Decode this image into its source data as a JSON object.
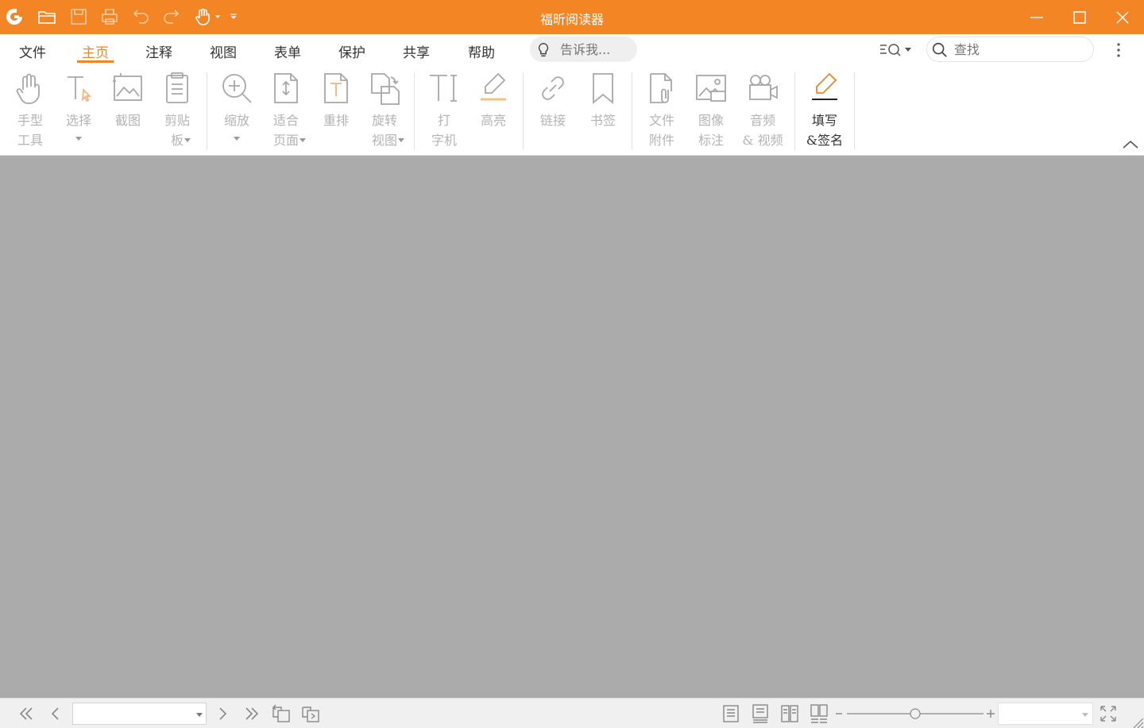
{
  "window": {
    "title": "福昕阅读器",
    "accent_color": "#f48525",
    "quick_access_icons": [
      "foxit-logo-icon",
      "open-folder-icon",
      "save-icon",
      "print-icon",
      "undo-icon",
      "redo-icon",
      "hand-tool-icon",
      "customize-toolbar-icon"
    ],
    "controls": [
      "minimize-icon",
      "maximize-icon",
      "close-icon"
    ]
  },
  "tabs": [
    {
      "label": "文件",
      "active": false
    },
    {
      "label": "主页",
      "active": true
    },
    {
      "label": "注释",
      "active": false
    },
    {
      "label": "视图",
      "active": false
    },
    {
      "label": "表单",
      "active": false
    },
    {
      "label": "保护",
      "active": false
    },
    {
      "label": "共享",
      "active": false
    },
    {
      "label": "帮助",
      "active": false
    }
  ],
  "tell_me": {
    "placeholder": "告诉我..."
  },
  "find": {
    "placeholder": "查找"
  },
  "ribbon": {
    "hand_tool": "手型\n工具",
    "select": "选择",
    "snapshot": "截图",
    "clipboard": "剪贴\n板",
    "zoom": "缩放",
    "fit_page": "适合\n页面",
    "reflow": "重排",
    "rotate_view": "旋转\n视图",
    "typewriter": "打\n字机",
    "highlight": "高亮",
    "link": "链接",
    "bookmark": "书签",
    "file_attachment": "文件\n附件",
    "image_annotation": "图像\n标注",
    "audio_video": "音频\n& 视频",
    "fill_sign": "填写\n&签名"
  },
  "status_bar": {
    "page_value": "",
    "zoom_value": "",
    "icons": [
      "first-page-icon",
      "previous-page-icon",
      "next-page-icon",
      "last-page-icon",
      "previous-view-icon",
      "next-view-icon",
      "single-page-icon",
      "continuous-page-icon",
      "facing-page-icon",
      "continuous-facing-icon",
      "zoom-out-icon",
      "zoom-in-icon",
      "full-screen-icon"
    ]
  }
}
